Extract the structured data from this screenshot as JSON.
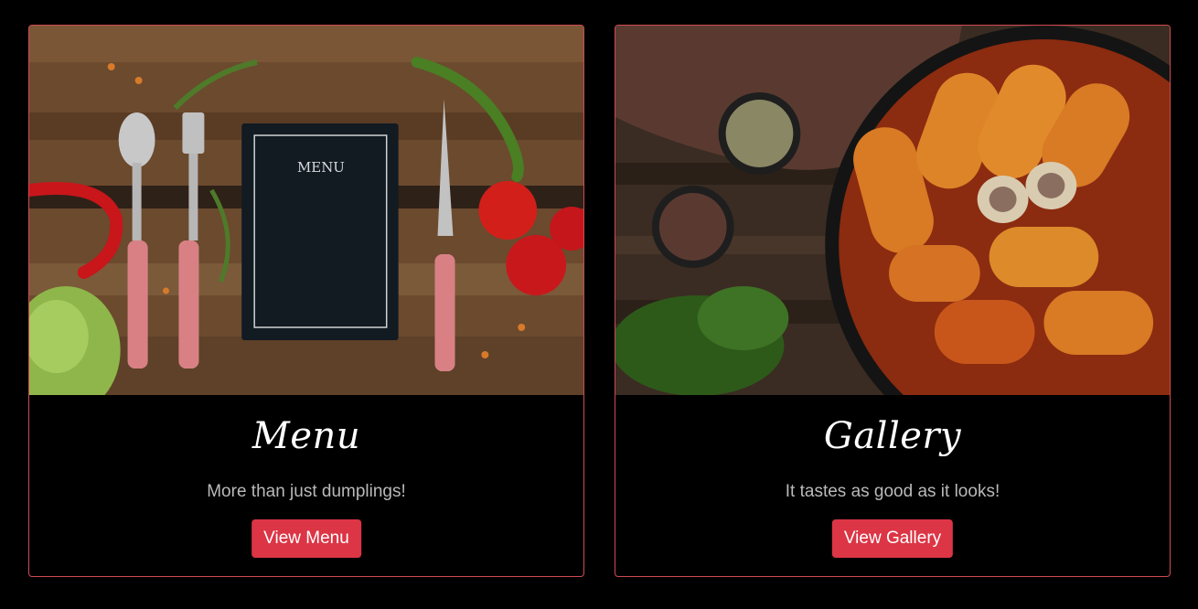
{
  "cards": [
    {
      "id": "menu",
      "image_alt": "Menu board with cutlery, tomatoes and herbs on wooden table",
      "image_text": "MENU",
      "title": "Menu",
      "text": "More than just dumplings!",
      "button_label": "View Menu"
    },
    {
      "id": "gallery",
      "image_alt": "Stuffed cabbage rolls in a black pan with spices and parsley",
      "title": "Gallery",
      "text": "It tastes as good as it looks!",
      "button_label": "View Gallery"
    }
  ],
  "colors": {
    "background": "#000000",
    "card_border": "#d04a52",
    "button": "#dc3545",
    "button_text": "#ffffff",
    "title": "#ffffff",
    "text": "#b9b9b9"
  }
}
